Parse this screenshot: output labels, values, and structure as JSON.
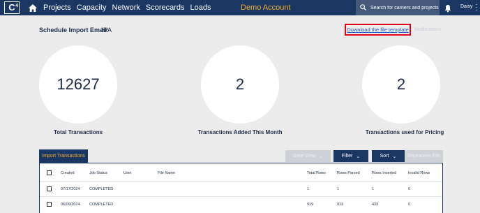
{
  "nav": {
    "logo_text": "C",
    "logo_sup": "4",
    "links": [
      "Projects",
      "Capacity",
      "Network",
      "Scorecards",
      "Loads"
    ],
    "account": "Demo Account",
    "search_placeholder": "Search for carriers and projects",
    "user": "Daisy",
    "colors": {
      "bar": "#1a3663",
      "account": "#f2b134",
      "search_bg": "#44597c"
    },
    "icons": [
      "home-icon",
      "search-icon",
      "bell-icon",
      "kebab-menu-icon"
    ]
  },
  "header": {
    "schedule_label": "Schedule Import Email:",
    "schedule_value": "N/A",
    "download_link": "Download the file template",
    "notifications": "Notifications",
    "highlight_color": "#e2001a"
  },
  "stats": [
    {
      "value": "12627",
      "label": "Total Transactions"
    },
    {
      "value": "2",
      "label": "Transactions Added This Month"
    },
    {
      "value": "2",
      "label": "Transactions used for Pricing"
    }
  ],
  "toolbar": {
    "tab": "Import Transactions",
    "save_view": "Save View",
    "filter": "Filter",
    "sort": "Sort",
    "reprocess": "Reprocess File"
  },
  "table": {
    "columns": [
      "Created",
      "Job Status",
      "User",
      "File Name",
      "Total Rows",
      "Rows Parsed",
      "Rows Inserted",
      "Invalid Rows"
    ],
    "rows": [
      [
        "07/17/2024",
        "COMPLETED",
        "",
        "",
        "1",
        "1",
        "1",
        "0"
      ],
      [
        "06/09/2024",
        "COMPLETED",
        "",
        "",
        "919",
        "919",
        "432",
        "0"
      ]
    ]
  }
}
